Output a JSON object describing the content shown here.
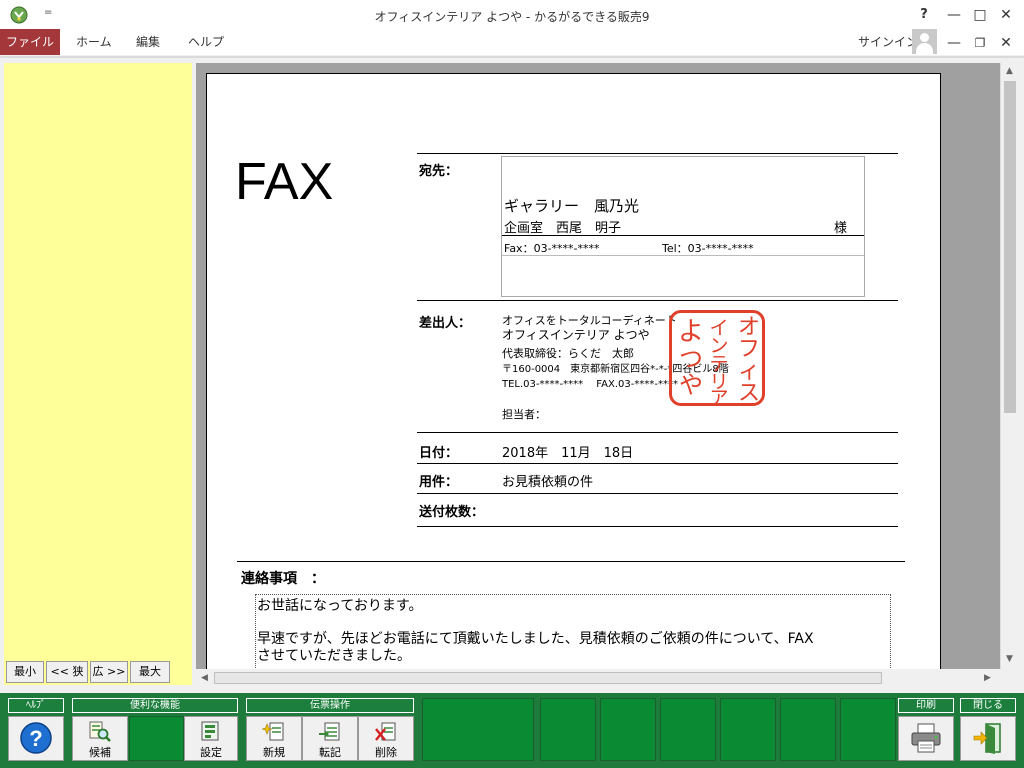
{
  "window": {
    "title": "オフィスインテリア よつや - かるがるできる販売9",
    "help": "?",
    "qat": "="
  },
  "menubar": {
    "file": "ファイル",
    "home": "ホーム",
    "edit": "編集",
    "help": "ヘルプ",
    "signin": "サインイン"
  },
  "zoom": {
    "min": "最小",
    "narrow": "<< 狭",
    "wide": "広 >>",
    "max": "最大"
  },
  "fax": {
    "title": "FAX",
    "to_label": "宛先：",
    "to_company": "ギャラリー　風乃光",
    "to_dept_person": "企画室　西尾　明子",
    "honorific": "様",
    "to_fax": "Fax：03-****-****",
    "to_tel": "Tel：03-****-****",
    "from_label": "差出人：",
    "from_lines": [
      "オフィスをトータルコーディネート",
      "オフィスインテリア よつや",
      "代表取締役：らくだ　太郎",
      "〒160-0004　東京都新宿区四谷*-*-*四谷ビル8階",
      "TEL.03-****-****　 FAX.03-****-****"
    ],
    "person_in_charge": "担当者：",
    "stamp_text": [
      "オ",
      "フ",
      "ィ",
      "ス",
      "イ",
      "ン",
      "テ",
      "リ",
      "ア",
      "よ",
      "つ",
      "や"
    ],
    "date_label": "日付：",
    "date_value": "2018年　11月　18日",
    "subject_label": "用件：",
    "subject_value": "お見積依頼の件",
    "pages_label": "送付枚数：",
    "notes_label": "連絡事項　：",
    "notes_line1": "お世話になっております。",
    "notes_line2": "早速ですが、先ほどお電話にて頂戴いたしました、見積依頼のご依頼の件について、FAX",
    "notes_line3": "させていただきました。"
  },
  "toolbar": {
    "help_group": "ﾍﾙﾌﾟ",
    "convenience_group": "便利な機能",
    "slip_group": "伝票操作",
    "print_group": "印刷",
    "close_group": "閉じる",
    "candidate": "候補",
    "settings": "設定",
    "new": "新規",
    "transfer": "転記",
    "delete": "削除"
  },
  "colors": {
    "file_tab": "#a4373a",
    "left_panel": "#ffff99",
    "toolbar_green": "#1e7b3c",
    "stamp_red": "#e0402a"
  }
}
